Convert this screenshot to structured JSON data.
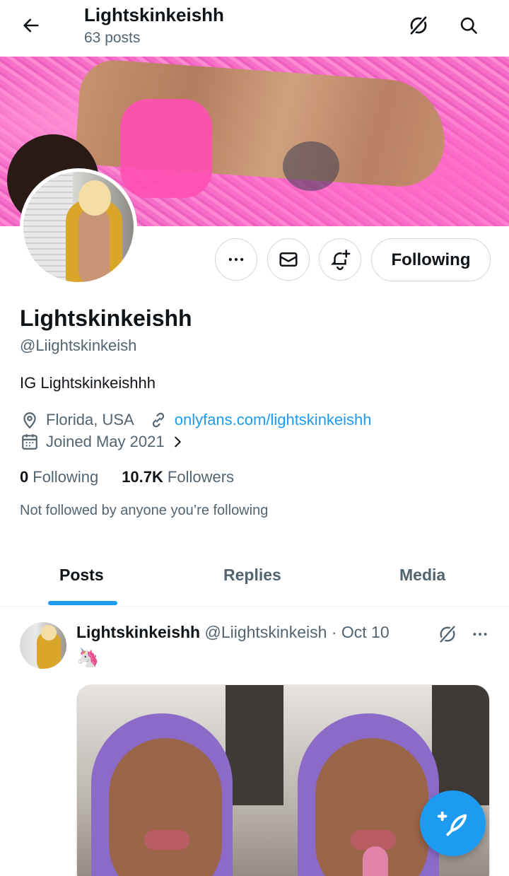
{
  "header": {
    "title": "Lightskinkeishh",
    "subtitle": "63 posts"
  },
  "profile": {
    "display_name": "Lightskinkeishh",
    "handle": "@Liightskinkeish",
    "bio": "IG Lightskinkeishhh",
    "location": "Florida, USA",
    "website": "onlyfans.com/lightskinkeishh",
    "joined": "Joined May 2021",
    "following_count": "0",
    "following_label": "Following",
    "followers_count": "10.7K",
    "followers_label": "Followers",
    "not_followed": "Not followed by anyone you’re following"
  },
  "actions": {
    "follow_label": "Following"
  },
  "tabs": [
    {
      "label": "Posts",
      "active": true
    },
    {
      "label": "Replies",
      "active": false
    },
    {
      "label": "Media",
      "active": false
    }
  ],
  "post": {
    "name": "Lightskinkeishh",
    "handle": "@Liightskinkeish",
    "separator": "·",
    "time": "Oct 10",
    "text": "🦄"
  },
  "icons": {
    "back": "arrow-left-icon",
    "grok": "grok-icon",
    "search": "search-icon",
    "more": "more-horizontal-icon",
    "message": "envelope-icon",
    "notify": "bell-plus-icon",
    "location": "location-pin-icon",
    "link": "link-icon",
    "calendar": "calendar-icon",
    "chevron": "chevron-right-icon",
    "compose": "compose-feather-icon"
  },
  "colors": {
    "accent": "#1d9bf0",
    "text_primary": "#0f1419",
    "text_secondary": "#536471",
    "banner_pink": "#f46ec6"
  }
}
